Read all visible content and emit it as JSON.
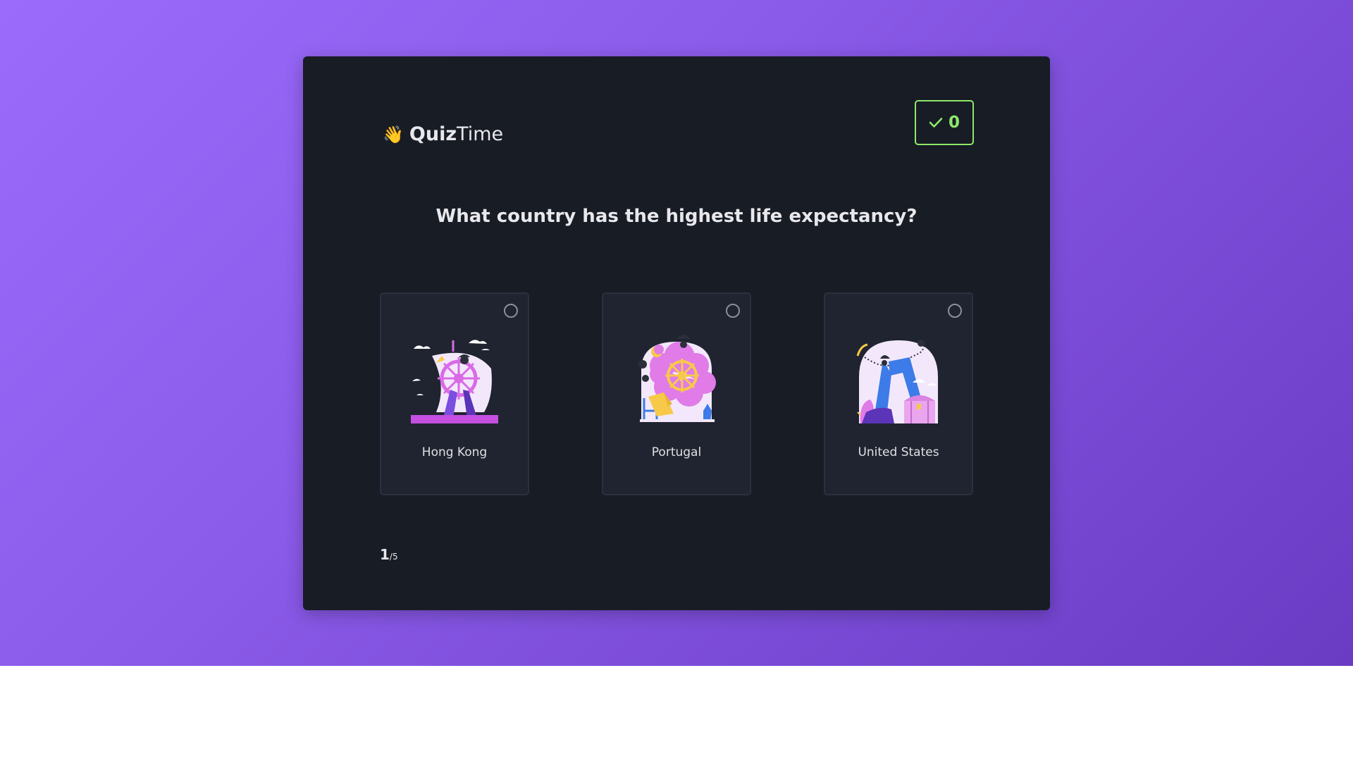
{
  "app": {
    "logo_bold": "Quiz",
    "logo_light": "Time",
    "logo_emoji": "👋"
  },
  "score": {
    "value": "0",
    "icon": "check-icon",
    "color": "#8ee86a"
  },
  "question": "What country has the highest life expectancy?",
  "options": [
    {
      "label": "Hong Kong",
      "image": "ship-wheel-illustration"
    },
    {
      "label": "Portugal",
      "image": "ship-wheel-clouds-illustration"
    },
    {
      "label": "United States",
      "image": "treasure-chest-illustration"
    }
  ],
  "progress": {
    "current": "1",
    "total": "/5"
  },
  "colors": {
    "background_start": "#9b6cfc",
    "background_end": "#6a3cc4",
    "card": "#181c25",
    "accent": "#8ee86a"
  }
}
